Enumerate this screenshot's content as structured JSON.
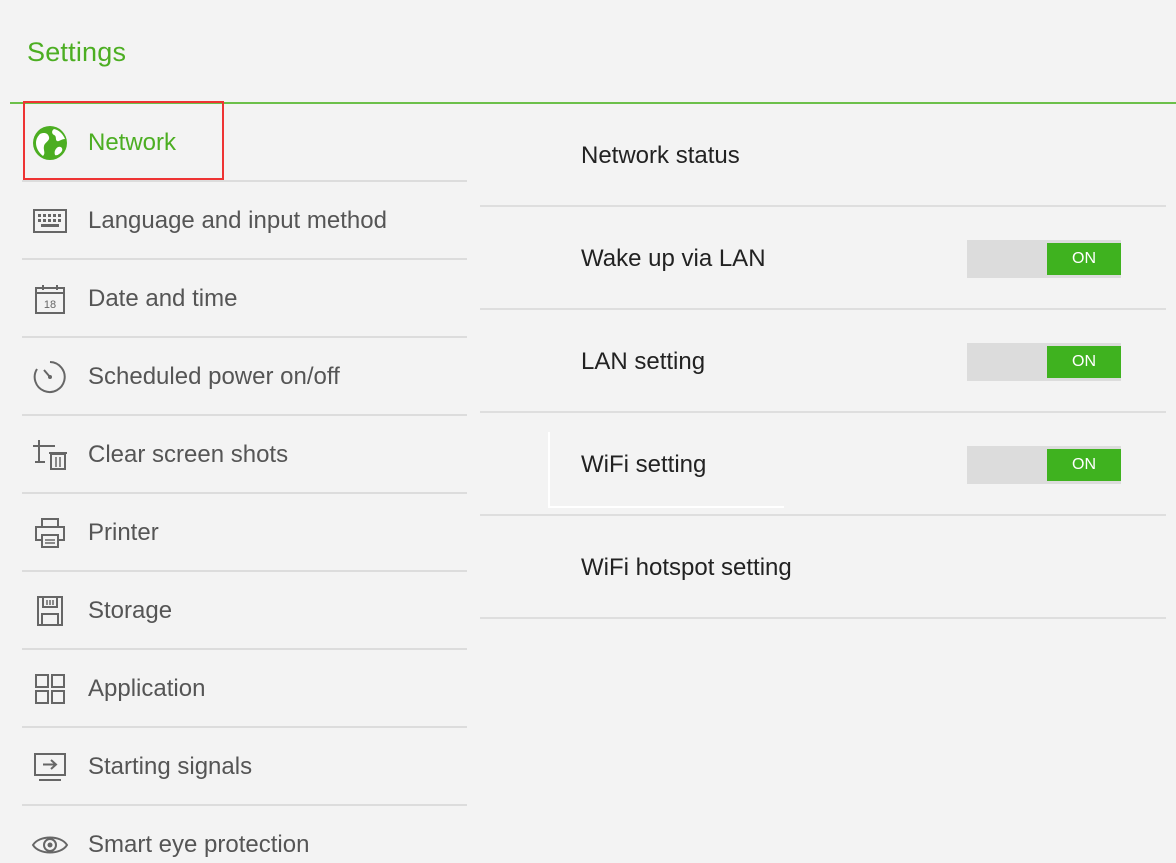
{
  "header": {
    "title": "Settings"
  },
  "sidebar": {
    "items": [
      {
        "label": "Network",
        "icon": "globe-icon",
        "active": true
      },
      {
        "label": "Language and input method",
        "icon": "keyboard-icon"
      },
      {
        "label": "Date and time",
        "icon": "calendar-icon"
      },
      {
        "label": "Scheduled power on/off",
        "icon": "timer-icon"
      },
      {
        "label": "Clear screen shots",
        "icon": "clear-screenshot-icon"
      },
      {
        "label": "Printer",
        "icon": "printer-icon"
      },
      {
        "label": "Storage",
        "icon": "storage-icon"
      },
      {
        "label": "Application",
        "icon": "grid-icon"
      },
      {
        "label": "Starting signals",
        "icon": "input-signal-icon"
      },
      {
        "label": "Smart eye protection",
        "icon": "eye-icon"
      }
    ],
    "calendar_day": "18"
  },
  "main": {
    "rows": [
      {
        "label": "Network status"
      },
      {
        "label": "Wake up via LAN",
        "toggle": "ON"
      },
      {
        "label": "LAN setting",
        "toggle": "ON"
      },
      {
        "label": "WiFi setting",
        "toggle": "ON"
      },
      {
        "label": "WiFi hotspot setting"
      }
    ]
  },
  "colors": {
    "accent": "#4cae22",
    "toggle_on": "#3fb21f",
    "highlight_outline": "#e33333"
  }
}
